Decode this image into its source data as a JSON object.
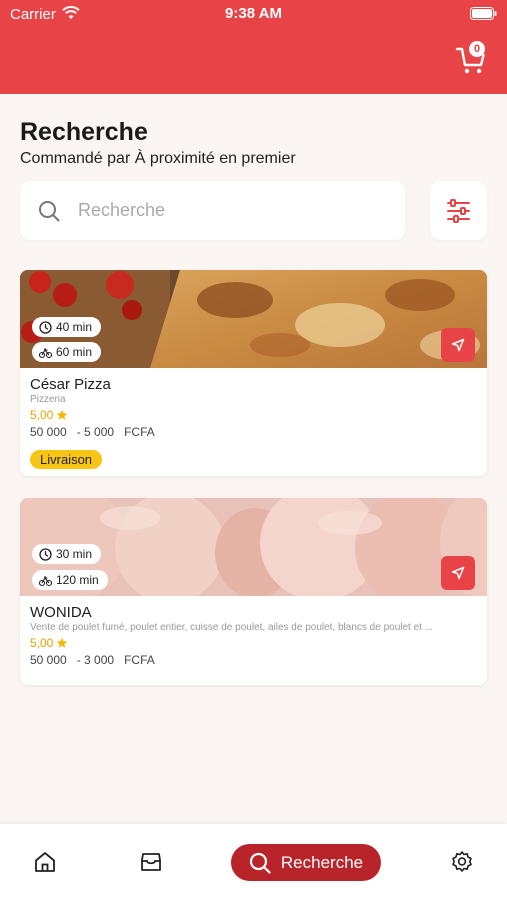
{
  "status_bar": {
    "carrier": "Carrier",
    "time": "9:38 AM"
  },
  "header": {
    "cart_count": "0"
  },
  "page": {
    "title": "Recherche",
    "subtitle": "Commandé par À proximité en premier"
  },
  "search": {
    "placeholder": "Recherche",
    "value": ""
  },
  "restaurants": [
    {
      "name": "César Pizza",
      "category": "Pizzeria",
      "rating": "5,00",
      "price_range": "50 000   - 5 000   FCFA",
      "prep_time": "40 min",
      "delivery_time": "60 min",
      "badge": "Livraison"
    },
    {
      "name": "WONIDA",
      "category": "Vente de poulet fumé, poulet entier, cuisse de poulet, ailes de poulet, blancs de poulet et ...",
      "rating": "5,00",
      "price_range": "50 000   - 3 000   FCFA",
      "prep_time": "30 min",
      "delivery_time": "120 min"
    }
  ],
  "tabbar": {
    "active_label": "Recherche"
  },
  "colors": {
    "brand": "#e84347",
    "active_tab": "#b9242a",
    "badge": "#f7c514",
    "star": "#e6a500"
  },
  "icons": [
    "wifi-icon",
    "battery-icon",
    "cart-icon",
    "search-icon",
    "filter-icon",
    "clock-icon",
    "bike-icon",
    "navigation-icon",
    "star-icon",
    "home-icon",
    "store-icon",
    "gear-icon"
  ]
}
